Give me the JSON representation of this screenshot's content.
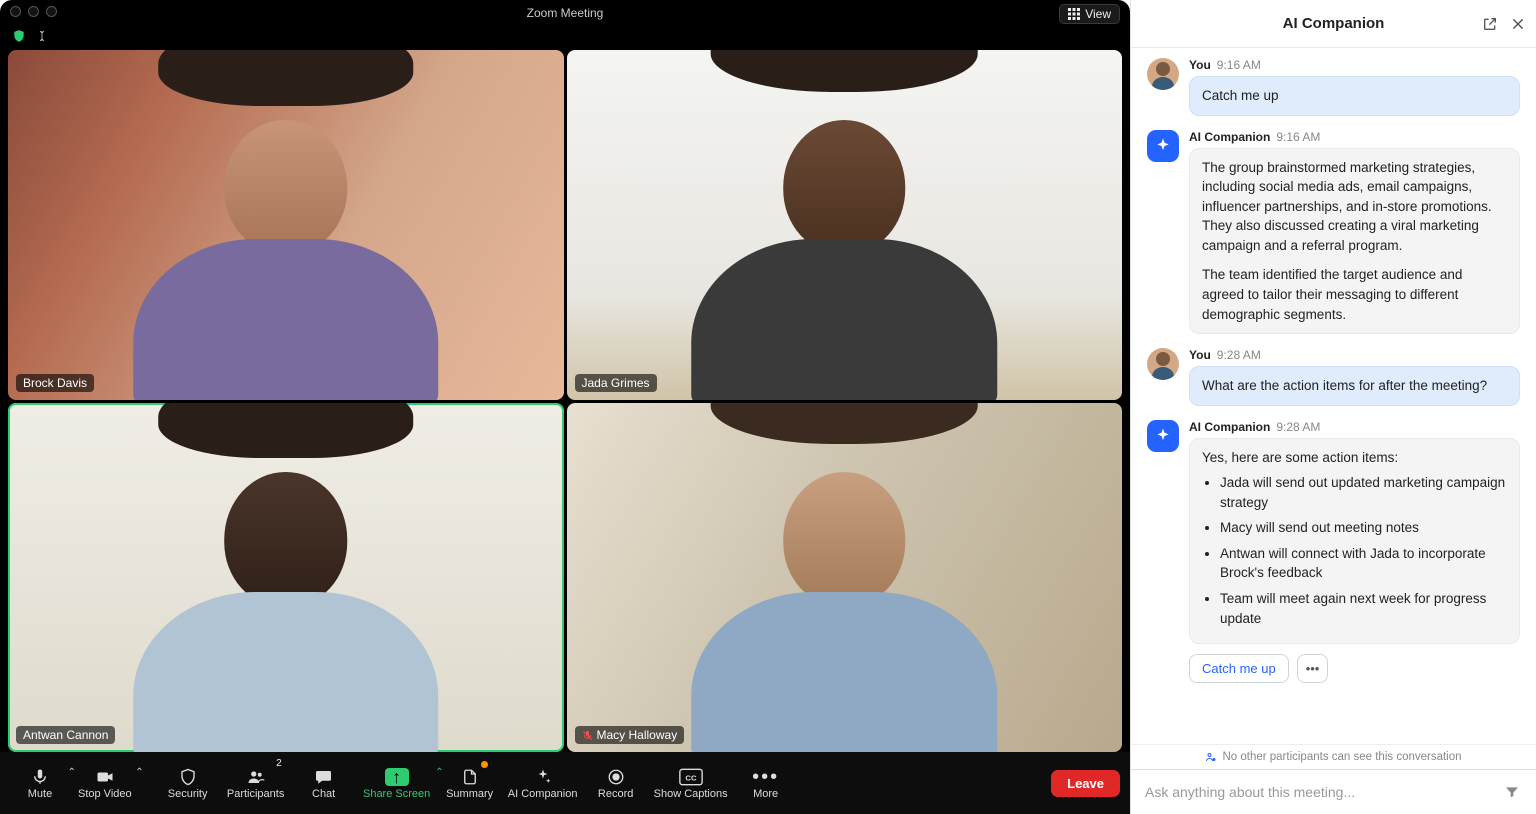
{
  "window": {
    "title": "Zoom Meeting",
    "view_label": "View"
  },
  "participants": [
    {
      "name": "Brock Davis",
      "active_speaker": false,
      "muted": false
    },
    {
      "name": "Jada Grimes",
      "active_speaker": false,
      "muted": false
    },
    {
      "name": "Antwan Cannon",
      "active_speaker": true,
      "muted": false
    },
    {
      "name": "Macy Halloway",
      "active_speaker": false,
      "muted": true
    }
  ],
  "toolbar": {
    "mute": "Mute",
    "stop_video": "Stop Video",
    "security": "Security",
    "participants": "Participants",
    "participants_count": "2",
    "chat": "Chat",
    "share_screen": "Share Screen",
    "summary": "Summary",
    "ai_companion": "AI Companion",
    "record": "Record",
    "show_captions": "Show Captions",
    "more": "More",
    "leave": "Leave"
  },
  "sidebar": {
    "title": "AI Companion",
    "messages": [
      {
        "sender": "You",
        "time": "9:16 AM",
        "type": "user",
        "text": "Catch me up"
      },
      {
        "sender": "AI Companion",
        "time": "9:16 AM",
        "type": "ai",
        "paragraphs": [
          "The group brainstormed marketing strategies, including social media ads, email campaigns, influencer partnerships, and in-store promotions. They also discussed creating a viral marketing campaign and a referral program.",
          "The team identified the target audience and agreed to tailor their messaging to different demographic segments."
        ]
      },
      {
        "sender": "You",
        "time": "9:28 AM",
        "type": "user",
        "text": "What are the action items for after the meeting?"
      },
      {
        "sender": "AI Companion",
        "time": "9:28 AM",
        "type": "ai",
        "intro": "Yes, here are some action items:",
        "items": [
          "Jada will send out updated marketing campaign strategy",
          "Macy will send out meeting notes",
          "Antwan will connect with Jada to incorporate Brock's feedback",
          "Team will meet again next week for progress update"
        ]
      }
    ],
    "suggestion": "Catch me up",
    "privacy": "No other participants can see this conversation",
    "input_placeholder": "Ask anything about this meeting..."
  }
}
